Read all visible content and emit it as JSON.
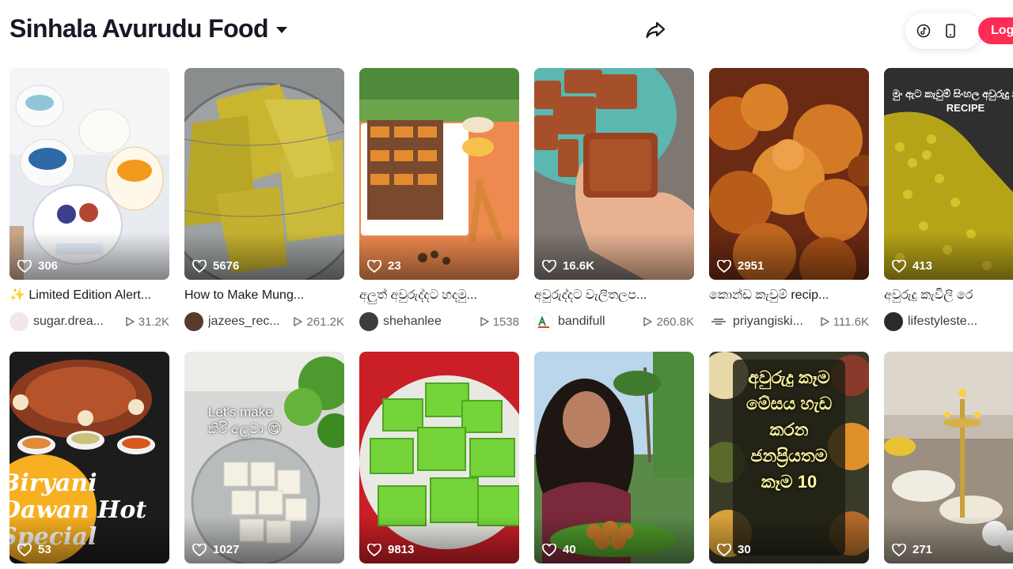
{
  "header": {
    "title": "Sinhala Avurudu Food",
    "login_label": "Log in"
  },
  "icons": {
    "share": "share-arrow-icon",
    "tiktok": "tiktok-note-icon",
    "phone": "mobile-phone-icon",
    "heart": "heart-outline-icon",
    "play": "play-outline-icon"
  },
  "colors": {
    "accent": "#fe2c55",
    "text": "#161823",
    "muted": "#6f7077"
  },
  "videos": [
    {
      "likes": "306",
      "caption": "✨ Limited Edition Alert...",
      "author": "sugar.drea...",
      "views": "31.2K"
    },
    {
      "likes": "5676",
      "caption": "How to Make Mung...",
      "author": "jazees_rec...",
      "views": "261.2K"
    },
    {
      "likes": "23",
      "caption": "අලුත් අවුරුද්දට හදමු...",
      "author": "shehanlee",
      "views": "1538"
    },
    {
      "likes": "16.6K",
      "caption": "අවුරුද්දට වැලිතලප...",
      "author": "bandifull",
      "views": "260.8K"
    },
    {
      "likes": "2951",
      "caption": "කොන්ඩ කැවුම් recip...",
      "author": "priyangiski...",
      "views": "111.6K"
    },
    {
      "likes": "413",
      "caption": "අවුරුදු කැවිලි රෙ",
      "author": "lifestyleste...",
      "views": ""
    },
    {
      "likes": "53",
      "overlay": "Biryani Dawan Hot Special"
    },
    {
      "likes": "1027",
      "overlay": "Let's make කිරි අලුවා 😋"
    },
    {
      "likes": "9813"
    },
    {
      "likes": "40"
    },
    {
      "likes": "30",
      "overlay": "අවුරුදු කෑම මේසය හැඩ කරන ජනප්‍රියතම කෑම 10"
    },
    {
      "likes": "271"
    }
  ],
  "thumb_overlays": {
    "v5": "මුං ඇට කැවුම් සිංහල අවුරුදු කැවිලි RECIPE"
  }
}
